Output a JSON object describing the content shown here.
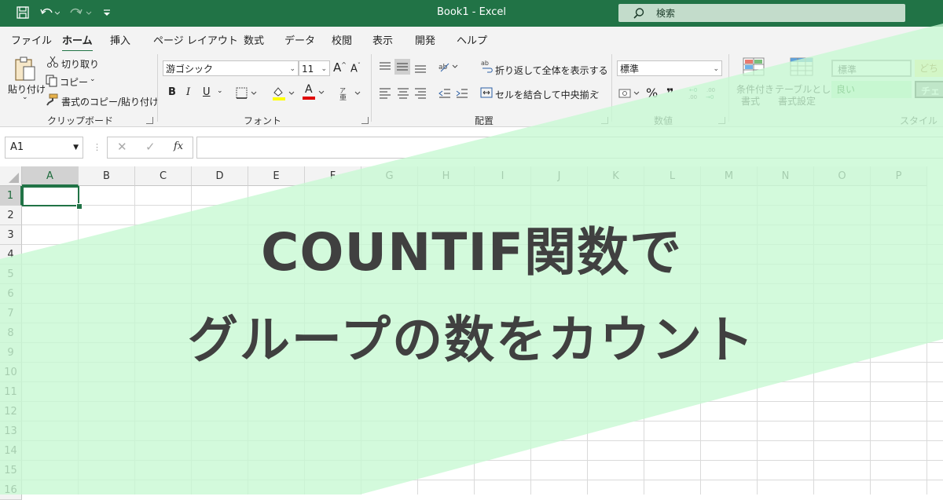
{
  "titlebar": {
    "title": "Book1  -  Excel",
    "search_placeholder": "検索",
    "colors": {
      "background": "#217346"
    }
  },
  "tabs": [
    "ファイル",
    "ホーム",
    "挿入",
    "ページ レイアウト",
    "数式",
    "データ",
    "校閲",
    "表示",
    "開発",
    "ヘルプ"
  ],
  "active_tab": "ホーム",
  "ribbon": {
    "clipboard": {
      "paste": "貼り付け",
      "cut": "切り取り",
      "copy": "コピー",
      "format_painter": "書式のコピー/貼り付け",
      "label": "クリップボード"
    },
    "font": {
      "name": "游ゴシック",
      "size": "11",
      "bold": "B",
      "italic": "I",
      "underline": "U",
      "font_color_letter": "A",
      "grow_font": "A",
      "shrink_font": "A",
      "label": "フォント"
    },
    "alignment": {
      "wrap_text": "折り返して全体を表示する",
      "merge_center": "セルを結合して中央揃え",
      "label": "配置"
    },
    "number": {
      "format": "標準",
      "percent": "%",
      "comma": "❞",
      "label": "数値"
    },
    "styles": {
      "conditional_formatting": [
        "条件付き",
        "書式"
      ],
      "format_as_table": [
        "テーブルとして",
        "書式設定"
      ],
      "normal": "標準",
      "good": "良い",
      "neutral": "どち",
      "check": "チェ",
      "label": "スタイル"
    }
  },
  "formula_bar": {
    "name_box": "A1",
    "fx": "fx",
    "formula": ""
  },
  "sheet": {
    "columns": [
      "A",
      "B",
      "C",
      "D",
      "E",
      "F",
      "G",
      "H",
      "I",
      "J",
      "K",
      "L",
      "M",
      "N",
      "O",
      "P"
    ],
    "rows": [
      "1",
      "2",
      "3",
      "4",
      "5",
      "6",
      "7",
      "8",
      "9",
      "10",
      "11",
      "12",
      "13",
      "14",
      "15",
      "16"
    ],
    "selected_column": "A",
    "selected_row": "1"
  },
  "overlay": {
    "headline_1": "COUNTIF関数で",
    "headline_2": "グループの数をカウント",
    "band_color": "#c6f8d2"
  }
}
